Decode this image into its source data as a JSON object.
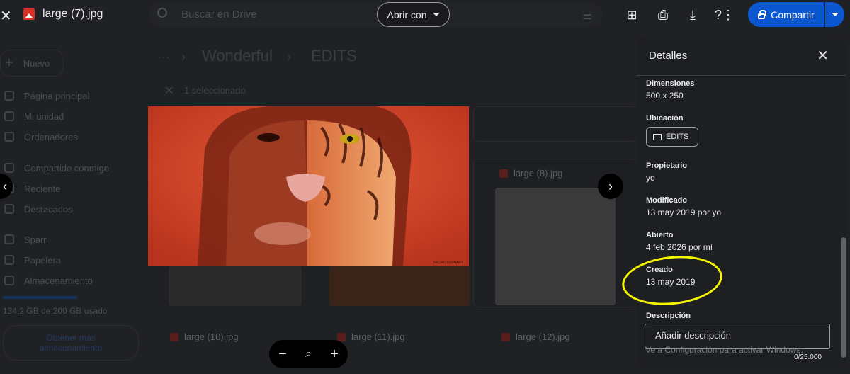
{
  "topbar": {
    "file_title": "large (7).jpg",
    "search_placeholder": "Buscar en Drive",
    "open_with_label": "Abrir con",
    "share_label": "Compartir"
  },
  "drive": {
    "new_label": "Nuevo",
    "sidebar": [
      "Página principal",
      "Mi unidad",
      "Ordenadores",
      "Compartido conmigo",
      "Reciente",
      "Destacados",
      "Spam",
      "Papelera",
      "Almacenamiento"
    ],
    "storage_text": "134,2 GB de 200 GB usado",
    "get_more_storage": "Obtener más almacenamiento",
    "breadcrumb_parent": "Wonderful",
    "breadcrumb_current": "EDITS",
    "selection_label": "1 seleccionado",
    "files": [
      "large (8).jpg",
      "large (10).jpg",
      "large (11).jpg",
      "large (12).jpg"
    ]
  },
  "preview": {
    "image_credit": "TECNICTOONART"
  },
  "details": {
    "title": "Detalles",
    "fields": {
      "dimensions": {
        "label": "Dimensiones",
        "value": "500 x 250"
      },
      "location": {
        "label": "Ubicación",
        "value": "EDITS"
      },
      "owner": {
        "label": "Propietario",
        "value": "yo"
      },
      "modified": {
        "label": "Modificado",
        "value": "13 may 2019 por yo"
      },
      "opened": {
        "label": "Abierto",
        "value": "4 feb 2026 por mí"
      },
      "created": {
        "label": "Creado",
        "value": "13 may 2019"
      },
      "description": {
        "label": "Descripción",
        "placeholder": "Añadir descripción",
        "count": "0/25.000"
      }
    },
    "watermark": "Ve a Configuración para activar Windows."
  },
  "colors": {
    "accent": "#0b57d0",
    "highlight": "#f5f500"
  }
}
